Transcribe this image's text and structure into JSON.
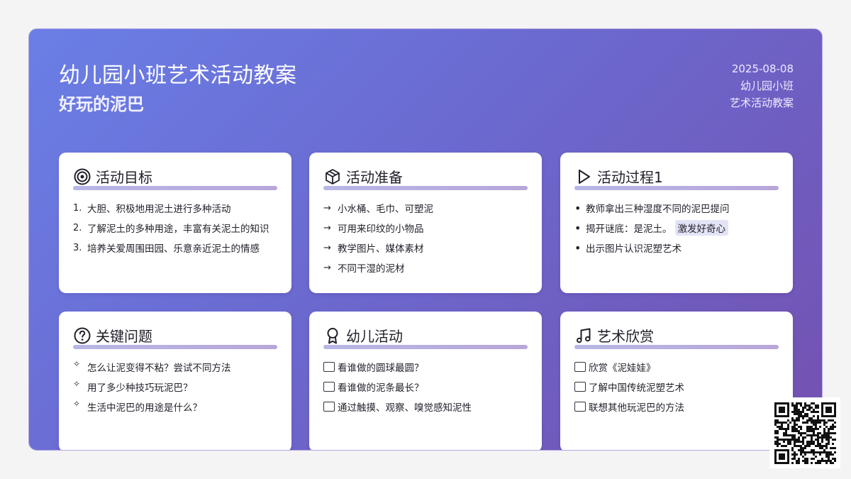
{
  "header": {
    "title": "幼儿园小班艺术活动教案",
    "subtitle": "好玩的泥巴",
    "date": "2025-08-08",
    "class_name": "幼儿园小班",
    "doc_type": "艺术活动教案"
  },
  "colors": {
    "gradient_start": "#6a7fe6",
    "gradient_end": "#7451b0",
    "card_background": "#ffffff",
    "title_bar": "#b7b7e6"
  },
  "cards": [
    {
      "icon": "target-icon",
      "title": "活动目标",
      "marker": "number",
      "items": [
        {
          "marker": "1.",
          "text": "大胆、积极地用泥土进行多种活动"
        },
        {
          "marker": "2.",
          "text": "了解泥土的多种用途，丰富有关泥土的知识"
        },
        {
          "marker": "3.",
          "text": "培养关爱周围田园、乐意亲近泥土的情感"
        }
      ]
    },
    {
      "icon": "package-icon",
      "title": "活动准备",
      "marker": "arrow",
      "items": [
        {
          "marker": "→",
          "text": "小水桶、毛巾、可塑泥"
        },
        {
          "marker": "→",
          "text": "可用来印纹的小物品"
        },
        {
          "marker": "→",
          "text": "教学图片、媒体素材"
        },
        {
          "marker": "→",
          "text": "不同干湿的泥材"
        }
      ]
    },
    {
      "icon": "play-icon",
      "title": "活动过程1",
      "marker": "bullet",
      "items": [
        {
          "marker": "•",
          "text": "教师拿出三种湿度不同的泥巴提问"
        },
        {
          "marker": "•",
          "text": "揭开谜底：是泥土。",
          "highlight": "激发好奇心"
        },
        {
          "marker": "•",
          "text": "出示图片认识泥塑艺术"
        }
      ]
    },
    {
      "icon": "question-circle-icon",
      "title": "关键问题",
      "marker": "sparkle",
      "items": [
        {
          "marker": "✧",
          "text": "怎么让泥变得不粘？尝试不同方法"
        },
        {
          "marker": "✧",
          "text": "用了多少种技巧玩泥巴？"
        },
        {
          "marker": "✧",
          "text": "生活中泥巴的用途是什么？"
        }
      ]
    },
    {
      "icon": "award-icon",
      "title": "幼儿活动",
      "marker": "box",
      "items": [
        {
          "text": "看谁做的圆球最圆？"
        },
        {
          "text": "看谁做的泥条最长？"
        },
        {
          "text": "通过触摸、观察、嗅觉感知泥性"
        }
      ]
    },
    {
      "icon": "music-icon",
      "title": "艺术欣赏",
      "marker": "box",
      "items": [
        {
          "text": "欣赏《泥娃娃》"
        },
        {
          "text": "了解中国传统泥塑艺术"
        },
        {
          "text": "联想其他玩泥巴的方法"
        }
      ]
    }
  ],
  "qr_code": {
    "icon": "qr-code-icon"
  }
}
